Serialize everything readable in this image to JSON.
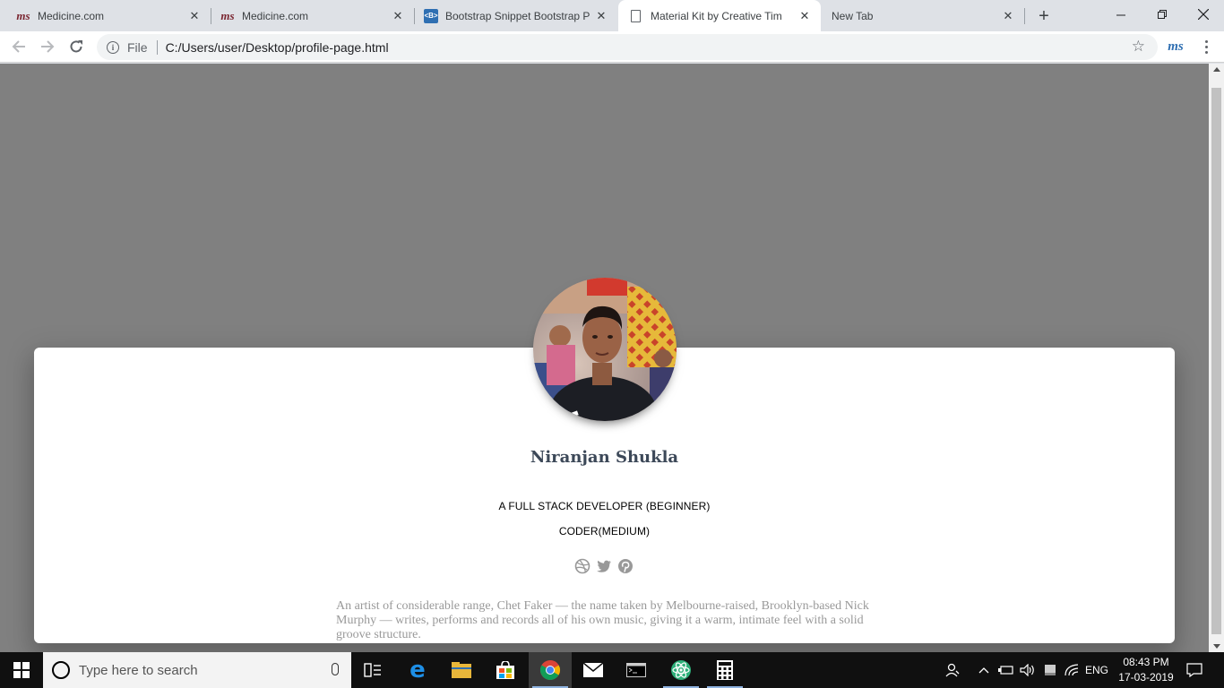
{
  "browser": {
    "tabs": [
      {
        "title": "Medicine.com",
        "favicon": "medicine-logo-icon"
      },
      {
        "title": "Medicine.com",
        "favicon": "medicine-logo-icon"
      },
      {
        "title": "Bootstrap Snippet Bootstrap P",
        "favicon": "bootstrap-snippet-icon"
      },
      {
        "title": "Material Kit by Creative Tim",
        "favicon": "document-icon",
        "active": true
      },
      {
        "title": "New Tab",
        "favicon": "none"
      }
    ],
    "omnibox": {
      "scheme_label": "File",
      "url": "C:/Users/user/Desktop/profile-page.html"
    }
  },
  "profile": {
    "name": "Niranjan Shukla",
    "role_1": "A FULL STACK DEVELOPER (BEGINNER)",
    "role_2": "CODER(MEDIUM)",
    "socials": [
      "dribbble-icon",
      "twitter-icon",
      "pinterest-icon"
    ],
    "bio": "An artist of considerable range, Chet Faker — the name taken by Melbourne-raised, Brooklyn-based Nick Murphy — writes, performs and records all of his own music, giving it a warm, intimate feel with a solid groove structure."
  },
  "taskbar": {
    "search_placeholder": "Type here to search",
    "language": "ENG",
    "time": "08:43 PM",
    "date": "17-03-2019"
  },
  "colors": {
    "page_background": "#808080",
    "card_background": "#ffffff",
    "name_color": "#3c4858",
    "bio_color": "#999999",
    "social_icon_color": "#999999"
  }
}
